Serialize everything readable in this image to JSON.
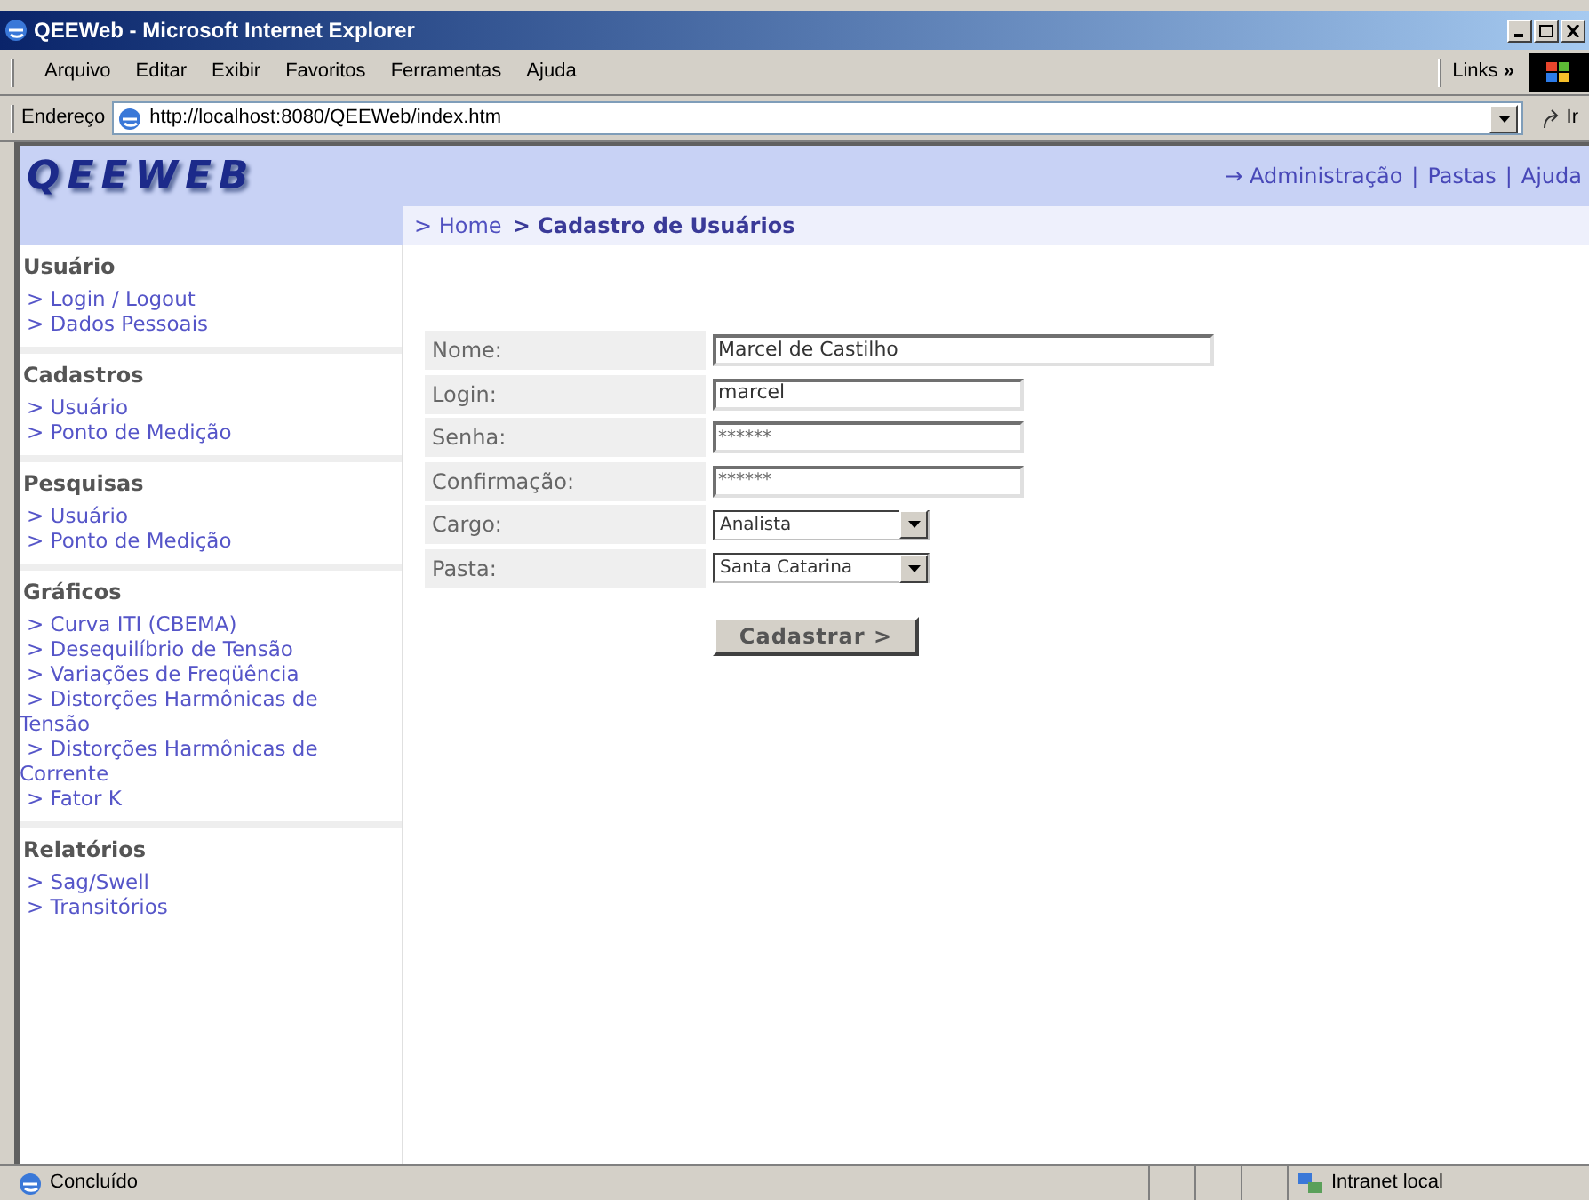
{
  "window": {
    "title": "QEEWeb - Microsoft Internet Explorer"
  },
  "menu": [
    "Arquivo",
    "Editar",
    "Exibir",
    "Favoritos",
    "Ferramentas",
    "Ajuda"
  ],
  "links_label": "Links",
  "links_chevron": "»",
  "address": {
    "label": "Endereço",
    "value": "http://localhost:8080/QEEWeb/index.htm",
    "go": "Ir"
  },
  "header": {
    "logo": "QEEWEB",
    "top_links": [
      "→ Administração",
      "Pastas",
      "Ajuda"
    ],
    "separator": "|"
  },
  "breadcrumb": [
    {
      "text": "> Home",
      "current": false
    },
    {
      "text": "> Cadastro de Usuários",
      "current": true
    }
  ],
  "sidebar": [
    {
      "title": "Usuário",
      "items": [
        "> Login / Logout",
        "> Dados Pessoais"
      ]
    },
    {
      "title": "Cadastros",
      "items": [
        "> Usuário",
        "> Ponto de Medição"
      ]
    },
    {
      "title": "Pesquisas",
      "items": [
        "> Usuário",
        "> Ponto de Medição"
      ]
    },
    {
      "title": "Gráficos",
      "items": [
        "> Curva ITI (CBEMA)",
        "> Desequilíbrio de Tensão",
        "> Variações de Freqüência",
        "> Distorções Harmônicas de Tensão",
        "> Distorções Harmônicas de Corrente",
        "> Fator K"
      ]
    },
    {
      "title": "Relatórios",
      "items": [
        "> Sag/Swell",
        "> Transitórios"
      ]
    }
  ],
  "form": [
    {
      "label": "Nome:",
      "kind": "long_text",
      "value": "Marcel de Castilho"
    },
    {
      "label": "Login:",
      "kind": "text",
      "value": "marcel"
    },
    {
      "label": "Senha:",
      "kind": "password",
      "value": "******"
    },
    {
      "label": "Confirmação:",
      "kind": "password",
      "value": "******"
    },
    {
      "label": "Cargo:",
      "kind": "select",
      "value": "Analista"
    },
    {
      "label": "Pasta:",
      "kind": "select",
      "value": "Santa Catarina"
    }
  ],
  "submit": "Cadastrar >",
  "status_bar": {
    "text": "Concluído",
    "zone": "Intranet local"
  }
}
